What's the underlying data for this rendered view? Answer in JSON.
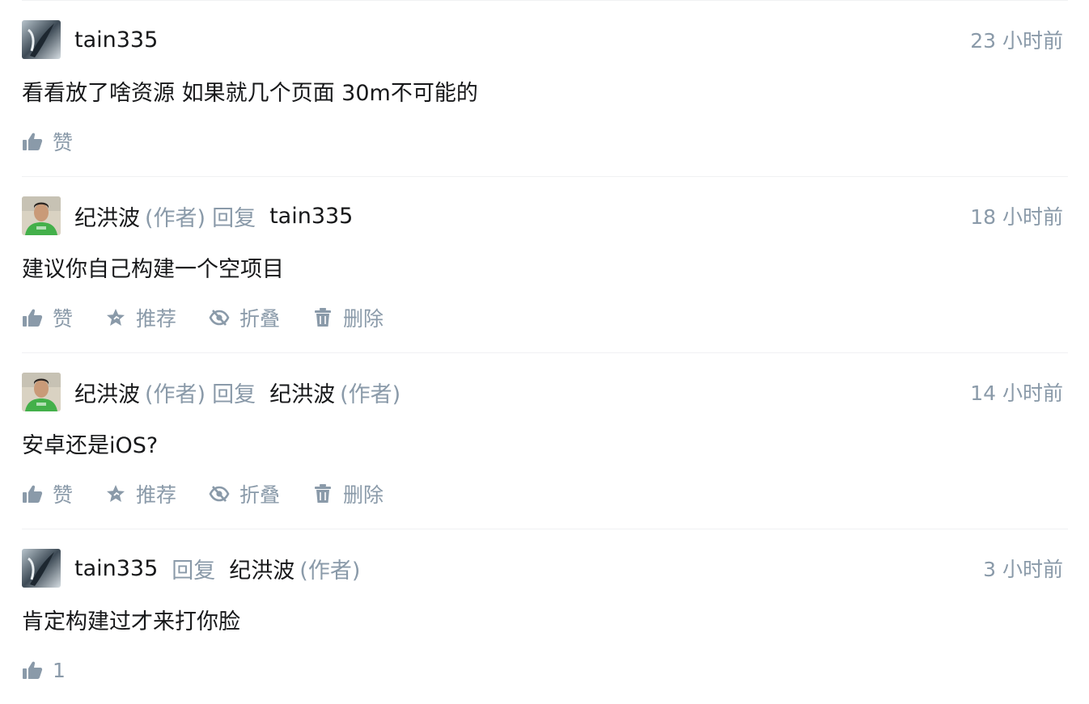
{
  "comments": [
    {
      "username": "tain335",
      "author_tag": "",
      "reply_word": "",
      "reply_to": "",
      "reply_to_tag": "",
      "time": "23 小时前",
      "text": "看看放了啥资源 如果就几个页面 30m不可能的",
      "like_label": "赞"
    },
    {
      "username": "纪洪波",
      "author_tag": "(作者)",
      "reply_word": "回复",
      "reply_to": "tain335",
      "reply_to_tag": "",
      "time": "18 小时前",
      "text": "建议你自己构建一个空项目",
      "like_label": "赞",
      "recommend_label": "推荐",
      "fold_label": "折叠",
      "delete_label": "删除"
    },
    {
      "username": "纪洪波",
      "author_tag": "(作者)",
      "reply_word": "回复",
      "reply_to": "纪洪波",
      "reply_to_tag": "(作者)",
      "time": "14 小时前",
      "text": "安卓还是iOS?",
      "like_label": "赞",
      "recommend_label": "推荐",
      "fold_label": "折叠",
      "delete_label": "删除"
    },
    {
      "username": "tain335",
      "author_tag": "",
      "reply_word": "回复",
      "reply_to": "纪洪波",
      "reply_to_tag": "(作者)",
      "time": "3 小时前",
      "text": "肯定构建过才来打你脸",
      "like_label": "1"
    }
  ],
  "colors": {
    "text": "#17181a",
    "muted": "#8a9aa9",
    "divider": "#f0f1f3"
  },
  "icons": {
    "like": "thumbs-up-icon",
    "recommend": "star-icon",
    "fold": "eye-slash-icon",
    "delete": "trash-icon"
  }
}
